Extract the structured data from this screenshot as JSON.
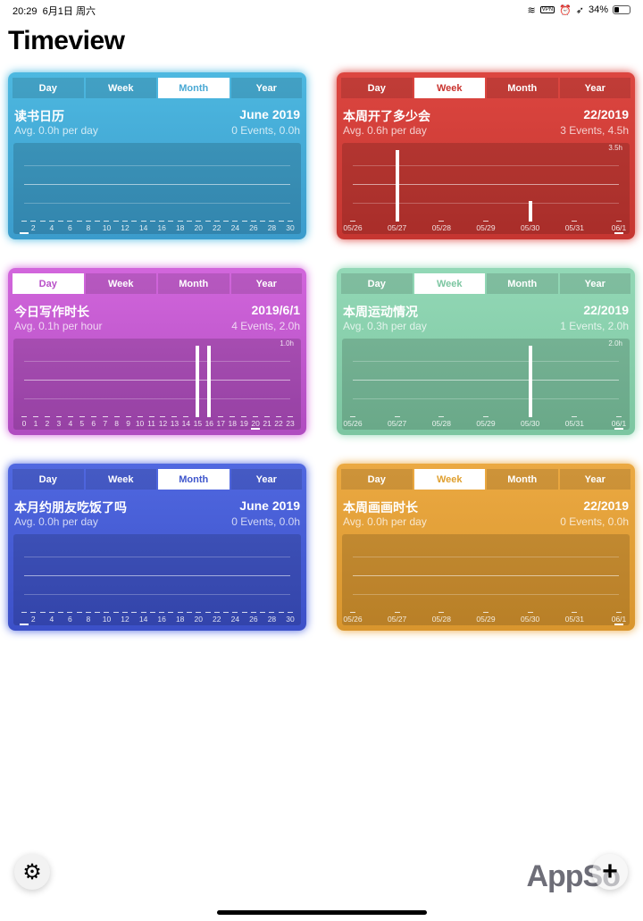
{
  "status": {
    "time": "20:29",
    "date": "6月1日 周六",
    "vpn": "VPN",
    "battery": "34%",
    "battery_level": 0.34
  },
  "app_title": "Timeview",
  "tab_labels": [
    "Day",
    "Week",
    "Month",
    "Year"
  ],
  "cards": [
    {
      "title": "读书日历",
      "period": "June 2019",
      "avg": "Avg. 0.0h per day",
      "events": "0 Events, 0.0h",
      "color": "#4db8e0",
      "color2": "#3b9ccc",
      "accent": "#4aa9d4",
      "active_tab": 2,
      "max_label": "",
      "highlight": 0,
      "labels": [
        "",
        "2",
        "",
        "4",
        "",
        "6",
        "",
        "8",
        "",
        "10",
        "",
        "12",
        "",
        "14",
        "",
        "16",
        "",
        "18",
        "",
        "20",
        "",
        "22",
        "",
        "24",
        "",
        "26",
        "",
        "28",
        "",
        "30"
      ],
      "values": [
        0,
        0,
        0,
        0,
        0,
        0,
        0,
        0,
        0,
        0,
        0,
        0,
        0,
        0,
        0,
        0,
        0,
        0,
        0,
        0,
        0,
        0,
        0,
        0,
        0,
        0,
        0,
        0,
        0,
        0
      ],
      "max": 1
    },
    {
      "title": "本周开了多少会",
      "period": "22/2019",
      "avg": "Avg. 0.6h per day",
      "events": "3 Events, 4.5h",
      "color": "#dc4640",
      "color2": "#c63631",
      "accent": "#c9332e",
      "active_tab": 1,
      "max_label": "3.5h",
      "highlight": 6,
      "labels": [
        "05/26",
        "05/27",
        "05/28",
        "05/29",
        "05/30",
        "05/31",
        "06/1"
      ],
      "values": [
        0,
        3.5,
        0,
        0,
        1.0,
        0,
        0
      ],
      "max": 3.5
    },
    {
      "title": "今日写作时长",
      "period": "2019/6/1",
      "avg": "Avg. 0.1h per hour",
      "events": "4 Events, 2.0h",
      "color": "#d266dc",
      "color2": "#b04cc0",
      "accent": "#b84fc8",
      "active_tab": 0,
      "max_label": "1.0h",
      "highlight": 20,
      "labels": [
        "0",
        "1",
        "2",
        "3",
        "4",
        "5",
        "6",
        "7",
        "8",
        "9",
        "10",
        "11",
        "12",
        "13",
        "14",
        "15",
        "16",
        "17",
        "18",
        "19",
        "20",
        "21",
        "22",
        "23"
      ],
      "values": [
        0,
        0,
        0,
        0,
        0,
        0,
        0,
        0,
        0,
        0,
        0,
        0,
        0,
        0,
        0,
        1.0,
        1.0,
        0,
        0,
        0,
        0,
        0,
        0,
        0
      ],
      "max": 1.0
    },
    {
      "title": "本周运动情况",
      "period": "22/2019",
      "avg": "Avg. 0.3h per day",
      "events": "1 Events, 2.0h",
      "color": "#93d8b6",
      "color2": "#7cc6a1",
      "accent": "#7cc6a1",
      "active_tab": 1,
      "max_label": "2.0h",
      "highlight": 6,
      "labels": [
        "05/26",
        "05/27",
        "05/28",
        "05/29",
        "05/30",
        "05/31",
        "06/1"
      ],
      "values": [
        0,
        0,
        0,
        0,
        2.0,
        0,
        0
      ],
      "max": 2.0
    },
    {
      "title": "本月约朋友吃饭了吗",
      "period": "June 2019",
      "avg": "Avg. 0.0h per day",
      "events": "0 Events, 0.0h",
      "color": "#5068e0",
      "color2": "#3c50c8",
      "accent": "#3f56cc",
      "active_tab": 2,
      "max_label": "",
      "highlight": 0,
      "labels": [
        "",
        "2",
        "",
        "4",
        "",
        "6",
        "",
        "8",
        "",
        "10",
        "",
        "12",
        "",
        "14",
        "",
        "16",
        "",
        "18",
        "",
        "20",
        "",
        "22",
        "",
        "24",
        "",
        "26",
        "",
        "28",
        "",
        "30"
      ],
      "values": [
        0,
        0,
        0,
        0,
        0,
        0,
        0,
        0,
        0,
        0,
        0,
        0,
        0,
        0,
        0,
        0,
        0,
        0,
        0,
        0,
        0,
        0,
        0,
        0,
        0,
        0,
        0,
        0,
        0,
        0
      ],
      "max": 1
    },
    {
      "title": "本周画画时长",
      "period": "22/2019",
      "avg": "Avg. 0.0h per day",
      "events": "0 Events, 0.0h",
      "color": "#eba942",
      "color2": "#d9962e",
      "accent": "#e0a030",
      "active_tab": 1,
      "max_label": "",
      "highlight": 6,
      "labels": [
        "05/26",
        "05/27",
        "05/28",
        "05/29",
        "05/30",
        "05/31",
        "06/1"
      ],
      "values": [
        0,
        0,
        0,
        0,
        0,
        0,
        0
      ],
      "max": 1
    }
  ],
  "watermark": "AppSo"
}
